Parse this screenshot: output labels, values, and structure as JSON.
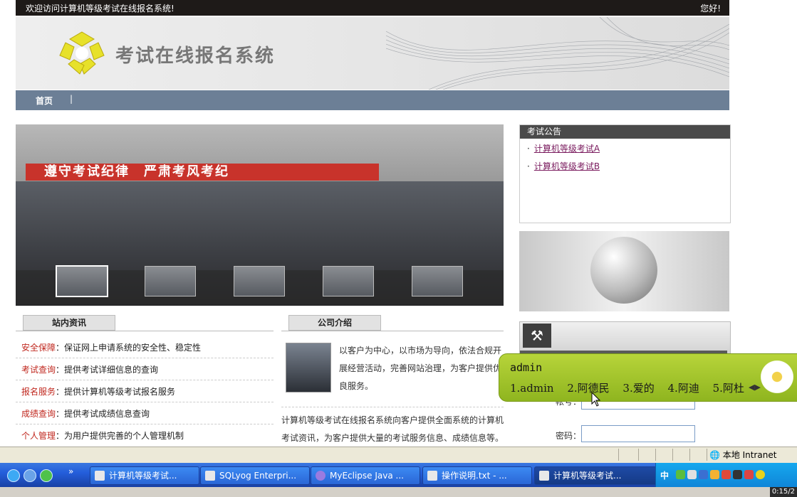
{
  "topbar": {
    "welcome": "欢迎访问计算机等级考试在线报名系统!",
    "greeting": "您好!"
  },
  "banner": {
    "title": "考试在线报名系统"
  },
  "nav": {
    "home": "首页",
    "sep": "|"
  },
  "slideshow": {
    "slogan": "遵守考试纪律　严肃考风考纪",
    "thumb_count": 5
  },
  "notice": {
    "header": "考试公告",
    "items": [
      {
        "label": "计算机等级考试A"
      },
      {
        "label": "计算机等级考试B"
      }
    ]
  },
  "login": {
    "account_label": "帐号：",
    "password_label": "密码：",
    "account_value": "",
    "password_value": ""
  },
  "news": {
    "header": "站内资讯",
    "items": [
      {
        "key": "安全保障",
        "text": "：保证网上申请系统的安全性、稳定性"
      },
      {
        "key": "考试查询",
        "text": "：提供考试详细信息的查询"
      },
      {
        "key": "报名服务",
        "text": "：提供计算机等级考试报名服务"
      },
      {
        "key": "成绩查询",
        "text": "：提供考试成绩信息查询"
      },
      {
        "key": "个人管理",
        "text": "：为用户提供完善的个人管理机制"
      }
    ]
  },
  "company": {
    "header": "公司介绍",
    "p1_line1": "以客户为中心，以市场为导向，依法合规开",
    "p1_line2": "展经营活动，完善网站治理，为客户提供优",
    "p1_line3": "良服务。",
    "p2_line1": "计算机等级考试在线报名系统向客户提供全面系统的计算机",
    "p2_line2": "考试资讯，为客户提供大量的考试服务信息、成绩信息等。"
  },
  "ime": {
    "typed": "admin",
    "candidates": [
      "1.admin",
      "2.阿德民",
      "3.爱的",
      "4.阿迪",
      "5.阿杜"
    ]
  },
  "statusbar": {
    "zone": "本地 Intranet"
  },
  "taskbar": {
    "buttons": [
      {
        "label": "计算机等级考试..."
      },
      {
        "label": "SQLyog Enterpri..."
      },
      {
        "label": "MyEclipse Java ..."
      },
      {
        "label": "操作说明.txt - ..."
      },
      {
        "label": "计算机等级考试..."
      }
    ],
    "ime_indicator": "中",
    "chevron": "»"
  },
  "clock": "0:15/2"
}
